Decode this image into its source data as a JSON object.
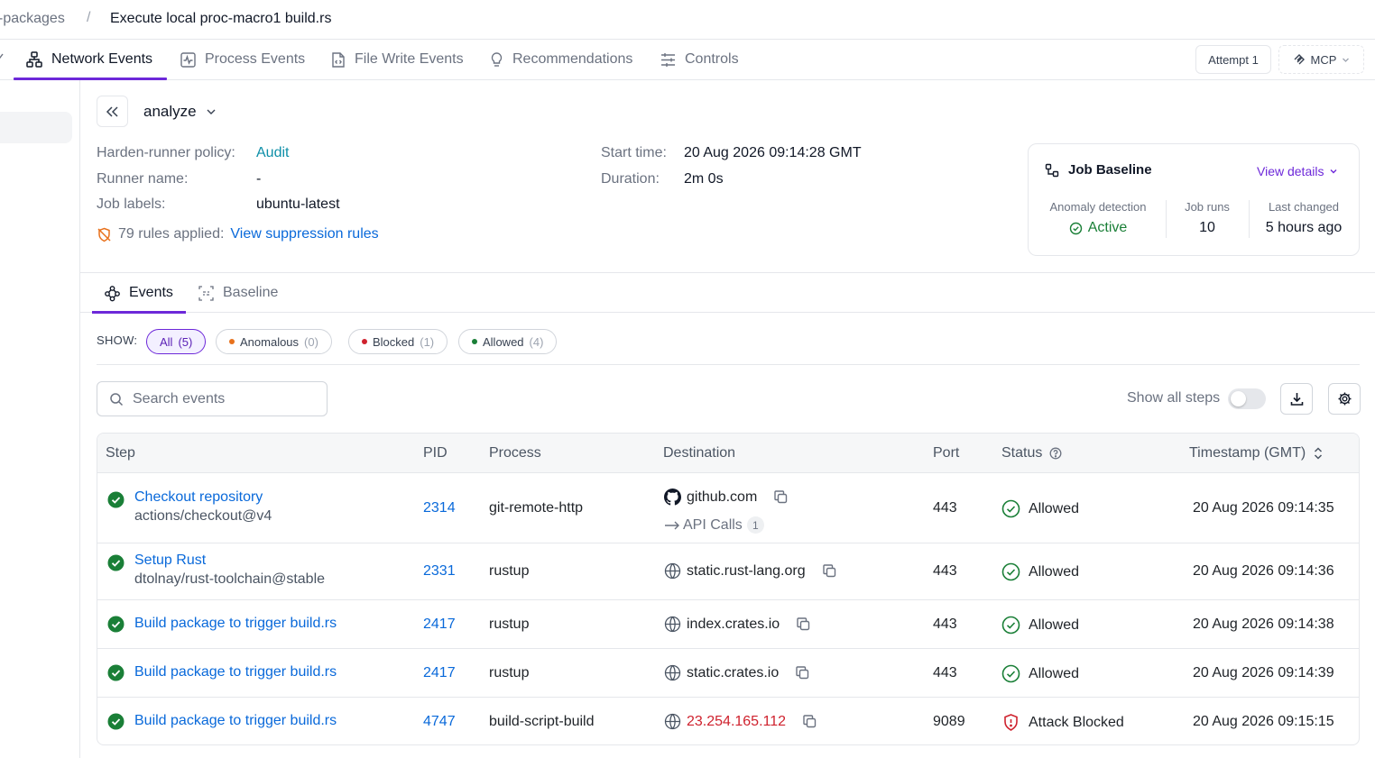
{
  "breadcrumb": {
    "parent": "-packages",
    "separator": "/",
    "current": "Execute local proc-macro1 build.rs"
  },
  "tabs": [
    {
      "label": "Network Events",
      "icon": "network-icon",
      "active": true
    },
    {
      "label": "Process Events",
      "icon": "activity-icon",
      "active": false
    },
    {
      "label": "File Write Events",
      "icon": "file-code-icon",
      "active": false
    },
    {
      "label": "Recommendations",
      "icon": "lightbulb-icon",
      "active": false
    },
    {
      "label": "Controls",
      "icon": "sliders-icon",
      "active": false
    }
  ],
  "header_actions": {
    "attempt_label": "Attempt 1",
    "mcp_label": "MCP"
  },
  "job": {
    "name": "analyze",
    "policy_label": "Harden-runner policy:",
    "policy_value": "Audit",
    "runner_label": "Runner name:",
    "runner_value": "-",
    "labels_label": "Job labels:",
    "labels_value": "ubuntu-latest",
    "rules_text": "79 rules applied:",
    "rules_link": "View suppression rules",
    "start_label": "Start time:",
    "start_value": "20 Aug 2026 09:14:28 GMT",
    "duration_label": "Duration:",
    "duration_value": "2m 0s"
  },
  "baseline": {
    "title": "Job Baseline",
    "view_details": "View details",
    "anomaly_label": "Anomaly detection",
    "anomaly_value": "Active",
    "runs_label": "Job runs",
    "runs_value": "10",
    "changed_label": "Last changed",
    "changed_value": "5 hours ago"
  },
  "subtabs": [
    {
      "label": "Events",
      "active": true
    },
    {
      "label": "Baseline",
      "active": false
    }
  ],
  "filters": {
    "show_label": "SHOW:",
    "chips": [
      {
        "label": "All",
        "count": "(5)",
        "active": true,
        "dot": ""
      },
      {
        "label": "Anomalous",
        "count": "(0)",
        "active": false,
        "dot": "#e8711c"
      },
      {
        "label": "Blocked",
        "count": "(1)",
        "active": false,
        "dot": "#cf222e"
      },
      {
        "label": "Allowed",
        "count": "(4)",
        "active": false,
        "dot": "#1a7f37"
      }
    ]
  },
  "search": {
    "placeholder": "Search events",
    "value": ""
  },
  "show_all_steps_label": "Show all steps",
  "table": {
    "columns": [
      "Step",
      "PID",
      "Process",
      "Destination",
      "Port",
      "Status",
      "Timestamp (GMT)"
    ],
    "rows": [
      {
        "step": "Checkout repository",
        "step_sub": "actions/checkout@v4",
        "pid": "2314",
        "process": "git-remote-http",
        "destination": "github.com",
        "dest_icon": "github-icon",
        "api_calls_label": "API Calls",
        "api_calls": "1",
        "port": "443",
        "status": "Allowed",
        "timestamp": "20 Aug 2026 09:14:35"
      },
      {
        "step": "Setup Rust",
        "step_sub": "dtolnay/rust-toolchain@stable",
        "pid": "2331",
        "process": "rustup",
        "destination": "static.rust-lang.org",
        "dest_icon": "globe-icon",
        "port": "443",
        "status": "Allowed",
        "timestamp": "20 Aug 2026 09:14:36"
      },
      {
        "step": "Build package to trigger build.rs",
        "step_sub": "",
        "pid": "2417",
        "process": "rustup",
        "destination": "index.crates.io",
        "dest_icon": "globe-icon",
        "port": "443",
        "status": "Allowed",
        "timestamp": "20 Aug 2026 09:14:38"
      },
      {
        "step": "Build package to trigger build.rs",
        "step_sub": "",
        "pid": "2417",
        "process": "rustup",
        "destination": "static.crates.io",
        "dest_icon": "globe-icon",
        "port": "443",
        "status": "Allowed",
        "timestamp": "20 Aug 2026 09:14:39"
      },
      {
        "step": "Build package to trigger build.rs",
        "step_sub": "",
        "pid": "4747",
        "process": "build-script-build",
        "destination": "23.254.165.112",
        "dest_icon": "globe-icon",
        "port": "9089",
        "status": "Attack Blocked",
        "timestamp": "20 Aug 2026 09:15:15"
      }
    ]
  },
  "colors": {
    "accent": "#6d28d9",
    "link": "#0969da",
    "success": "#1a7f37",
    "danger": "#cf222e"
  }
}
